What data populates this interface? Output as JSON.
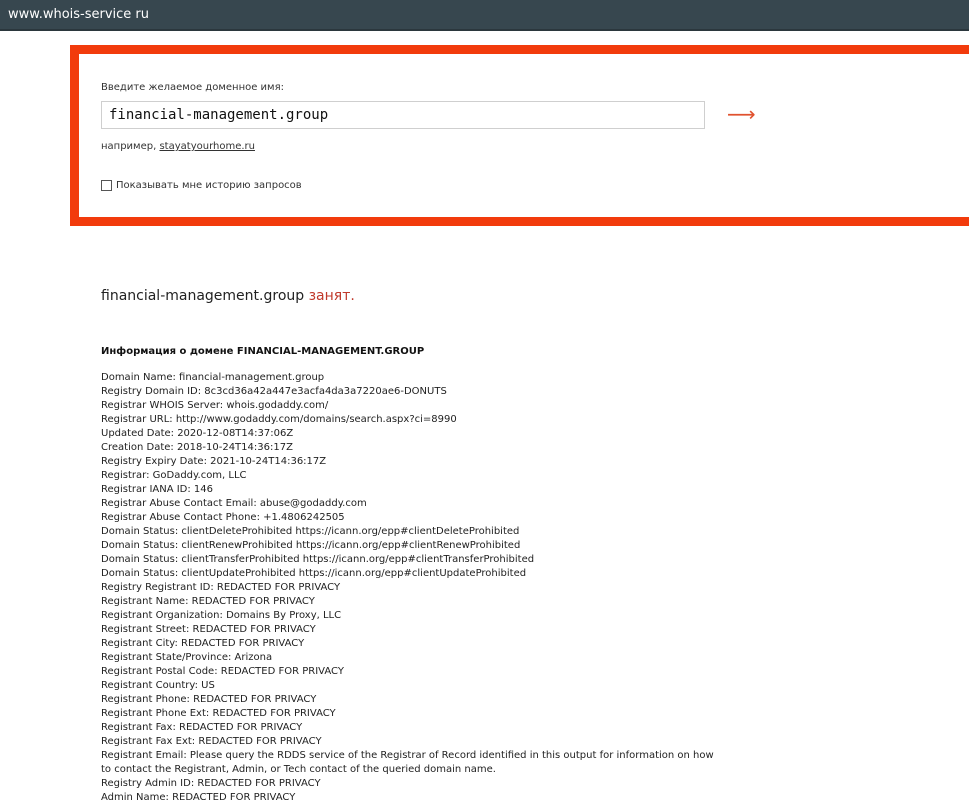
{
  "browser": {
    "url": "www.whois-service ru"
  },
  "search": {
    "label": "Введите желаемое доменное имя:",
    "value": "financial-management.group",
    "submit_icon": "arrow-right-icon",
    "example_prefix": "например,",
    "example_link": "stayatyourhome.ru",
    "history_label": "Показывать мне историю запросов",
    "history_checked": false,
    "accent_color": "#f23b0c"
  },
  "result": {
    "domain": "financial-management.group",
    "status": "занят.",
    "info_heading": "Информация о домене FINANCIAL-MANAGEMENT.GROUP"
  },
  "whois_lines": [
    "Domain Name: financial-management.group",
    "Registry Domain ID: 8c3cd36a42a447e3acfa4da3a7220ae6-DONUTS",
    "Registrar WHOIS Server: whois.godaddy.com/",
    "Registrar URL: http://www.godaddy.com/domains/search.aspx?ci=8990",
    "Updated Date: 2020-12-08T14:37:06Z",
    "Creation Date: 2018-10-24T14:36:17Z",
    "Registry Expiry Date: 2021-10-24T14:36:17Z",
    "Registrar: GoDaddy.com, LLC",
    "Registrar IANA ID: 146",
    "Registrar Abuse Contact Email: abuse@godaddy.com",
    "Registrar Abuse Contact Phone: +1.4806242505",
    "Domain Status: clientDeleteProhibited https://icann.org/epp#clientDeleteProhibited",
    "Domain Status: clientRenewProhibited https://icann.org/epp#clientRenewProhibited",
    "Domain Status: clientTransferProhibited https://icann.org/epp#clientTransferProhibited",
    "Domain Status: clientUpdateProhibited https://icann.org/epp#clientUpdateProhibited",
    "Registry Registrant ID: REDACTED FOR PRIVACY",
    "Registrant Name: REDACTED FOR PRIVACY",
    "Registrant Organization: Domains By Proxy, LLC",
    "Registrant Street: REDACTED FOR PRIVACY",
    "Registrant City: REDACTED FOR PRIVACY",
    "Registrant State/Province: Arizona",
    "Registrant Postal Code: REDACTED FOR PRIVACY",
    "Registrant Country: US",
    "Registrant Phone: REDACTED FOR PRIVACY",
    "Registrant Phone Ext: REDACTED FOR PRIVACY",
    "Registrant Fax: REDACTED FOR PRIVACY",
    "Registrant Fax Ext: REDACTED FOR PRIVACY",
    "Registrant Email: Please query the RDDS service of the Registrar of Record identified in this output for information on how",
    "to contact the Registrant, Admin, or Tech contact of the queried domain name.",
    "Registry Admin ID: REDACTED FOR PRIVACY",
    "Admin Name: REDACTED FOR PRIVACY"
  ]
}
